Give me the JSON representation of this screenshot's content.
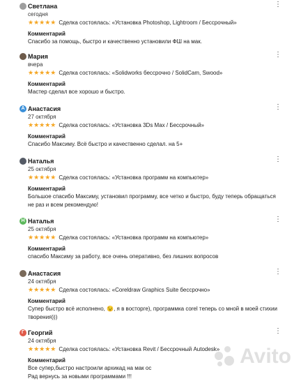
{
  "reviews": [
    {
      "name": "Светлана",
      "date": "сегодня",
      "avatar_color": "#9e9e9e",
      "avatar_letter": "",
      "deal": "Сделка состоялась: «Установка Photoshop, Lightroom / Бессрочный»",
      "comment_label": "Комментарий",
      "comment": "Спасибо за помощь, быстро и качественно установили ФШ на мак."
    },
    {
      "name": "Мария",
      "date": "вчера",
      "avatar_color": "#6d5a4a",
      "avatar_letter": "",
      "deal": "Сделка состоялась: «Solidworks бессрочно / SolidCam, Swood»",
      "comment_label": "Комментарий",
      "comment": "Мастер сделал все хорошо и быстро."
    },
    {
      "name": "Анастасия",
      "date": "27 октября",
      "avatar_color": "#3a8fd8",
      "avatar_letter": "А",
      "deal": "Сделка состоялась: «Установка 3Ds Max / Бессрочный»",
      "comment_label": "Комментарий",
      "comment": "Спасибо Максиму. Всё быстро и качественно сделал. на 5+"
    },
    {
      "name": "Наталья",
      "date": "25 октября",
      "avatar_color": "#555b66",
      "avatar_letter": "",
      "deal": "Сделка состоялась: «Установка программ на компьютер»",
      "comment_label": "Комментарий",
      "comment": "Большое спасибо Максиму, установил программу, все четко и быстро, буду теперь обращаться не раз и всем рекомендую!"
    },
    {
      "name": "Наталья",
      "date": "25 октября",
      "avatar_color": "#5cb85c",
      "avatar_letter": "Н",
      "deal": "Сделка состоялась: «Установка программ на компьютер»",
      "comment_label": "Комментарий",
      "comment": "спасибо Максиму за работу, все очень оперативно, без лишних вопросов"
    },
    {
      "name": "Анастасия",
      "date": "24 октября",
      "avatar_color": "#7a6a5a",
      "avatar_letter": "",
      "deal": "Сделка состоялась: «Coreldraw Graphics Suite бессрочно»",
      "comment_label": "Комментарий",
      "comment": "Супер быстро всё исполнено, 😉, я в восторге), программка corel теперь со мной в моей стихии творения)))"
    },
    {
      "name": "Георгий",
      "date": "24 октября",
      "avatar_color": "#e05a4a",
      "avatar_letter": "Г",
      "deal": "Сделка состоялась: «Установка Revit / Бессрочный Autodesk»",
      "comment_label": "Комментарий",
      "comment": "Все супер,быстро настроили архикад на мак ос\nРад вернусь за новыми программами !!!"
    }
  ],
  "stars_text": "★★★★★",
  "more_icon": "⋮",
  "watermark": {
    "text": "Avito",
    "color": "#c8c8c8"
  }
}
